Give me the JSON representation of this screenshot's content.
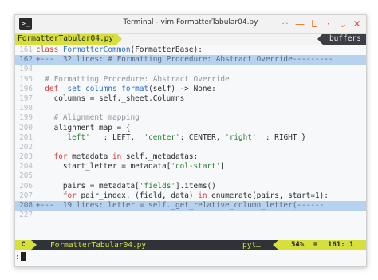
{
  "window": {
    "title": "Terminal - vim FormatterTabular04.py",
    "app_icon": ">_"
  },
  "controls": {
    "pin": "⁘",
    "minimize": "—",
    "maximize": "L",
    "shade": "·",
    "unmaximize": "⌄",
    "close": "✕"
  },
  "tabline": {
    "active_tab": "FormatterTabular04.py",
    "buffers_label": "buffers"
  },
  "lines": [
    {
      "num": "161",
      "segments": [
        [
          "kw",
          "class "
        ],
        [
          "fn",
          "FormatterCommon"
        ],
        [
          "",
          "(FormatterBase):"
        ]
      ]
    },
    {
      "num": "162",
      "folded": true,
      "segments": [
        [
          "",
          "+---  32 lines: # Formatting Procedure: Abstract Override---------"
        ]
      ]
    },
    {
      "num": "194",
      "segments": []
    },
    {
      "num": "195",
      "segments": [
        [
          "cm",
          "  # Formatting Procedure: Abstract Override"
        ]
      ]
    },
    {
      "num": "196",
      "segments": [
        [
          "kw",
          "  def "
        ],
        [
          "fn",
          "_set_columns_format"
        ],
        [
          "",
          "(self) -> None:"
        ]
      ]
    },
    {
      "num": "197",
      "segments": [
        [
          "",
          "    columns = self._sheet.Columns"
        ]
      ]
    },
    {
      "num": "198",
      "segments": []
    },
    {
      "num": "199",
      "segments": [
        [
          "cm",
          "    # Alignment mapping"
        ]
      ]
    },
    {
      "num": "200",
      "segments": [
        [
          "",
          "    alignment_map = {"
        ]
      ]
    },
    {
      "num": "201",
      "segments": [
        [
          "",
          "      "
        ],
        [
          "str",
          "'left'"
        ],
        [
          "",
          "   : LEFT,  "
        ],
        [
          "str",
          "'center'"
        ],
        [
          "",
          ": CENTER, "
        ],
        [
          "str",
          "'right'"
        ],
        [
          "",
          "  : RIGHT }"
        ]
      ]
    },
    {
      "num": "202",
      "segments": []
    },
    {
      "num": "203",
      "segments": [
        [
          "kw",
          "    for "
        ],
        [
          "",
          "metadata "
        ],
        [
          "kw",
          "in "
        ],
        [
          "",
          "self._metadatas:"
        ]
      ]
    },
    {
      "num": "204",
      "segments": [
        [
          "",
          "      start_letter = metadata["
        ],
        [
          "str",
          "'col-start'"
        ],
        [
          "",
          "]"
        ]
      ]
    },
    {
      "num": "205",
      "segments": []
    },
    {
      "num": "206",
      "segments": [
        [
          "",
          "      pairs = metadata["
        ],
        [
          "str",
          "'fields'"
        ],
        [
          "",
          "].items()"
        ]
      ]
    },
    {
      "num": "207",
      "segments": [
        [
          "kw",
          "      for "
        ],
        [
          "",
          "pair_index, (field, data) "
        ],
        [
          "kw",
          "in "
        ],
        [
          "",
          "enumerate(pairs, start=1):"
        ]
      ]
    },
    {
      "num": "208",
      "folded": true,
      "segments": [
        [
          "",
          "+---  19 lines: letter = self._get_relative_column_letter(------"
        ]
      ]
    },
    {
      "num": "227",
      "segments": []
    }
  ],
  "statusline": {
    "mode": "C",
    "file": "FormatterTabular04.py",
    "filetype": "pyt…",
    "percent": "54%",
    "position": "161:  1",
    "separator": "≡"
  },
  "cmdline": {
    "text": ":"
  }
}
